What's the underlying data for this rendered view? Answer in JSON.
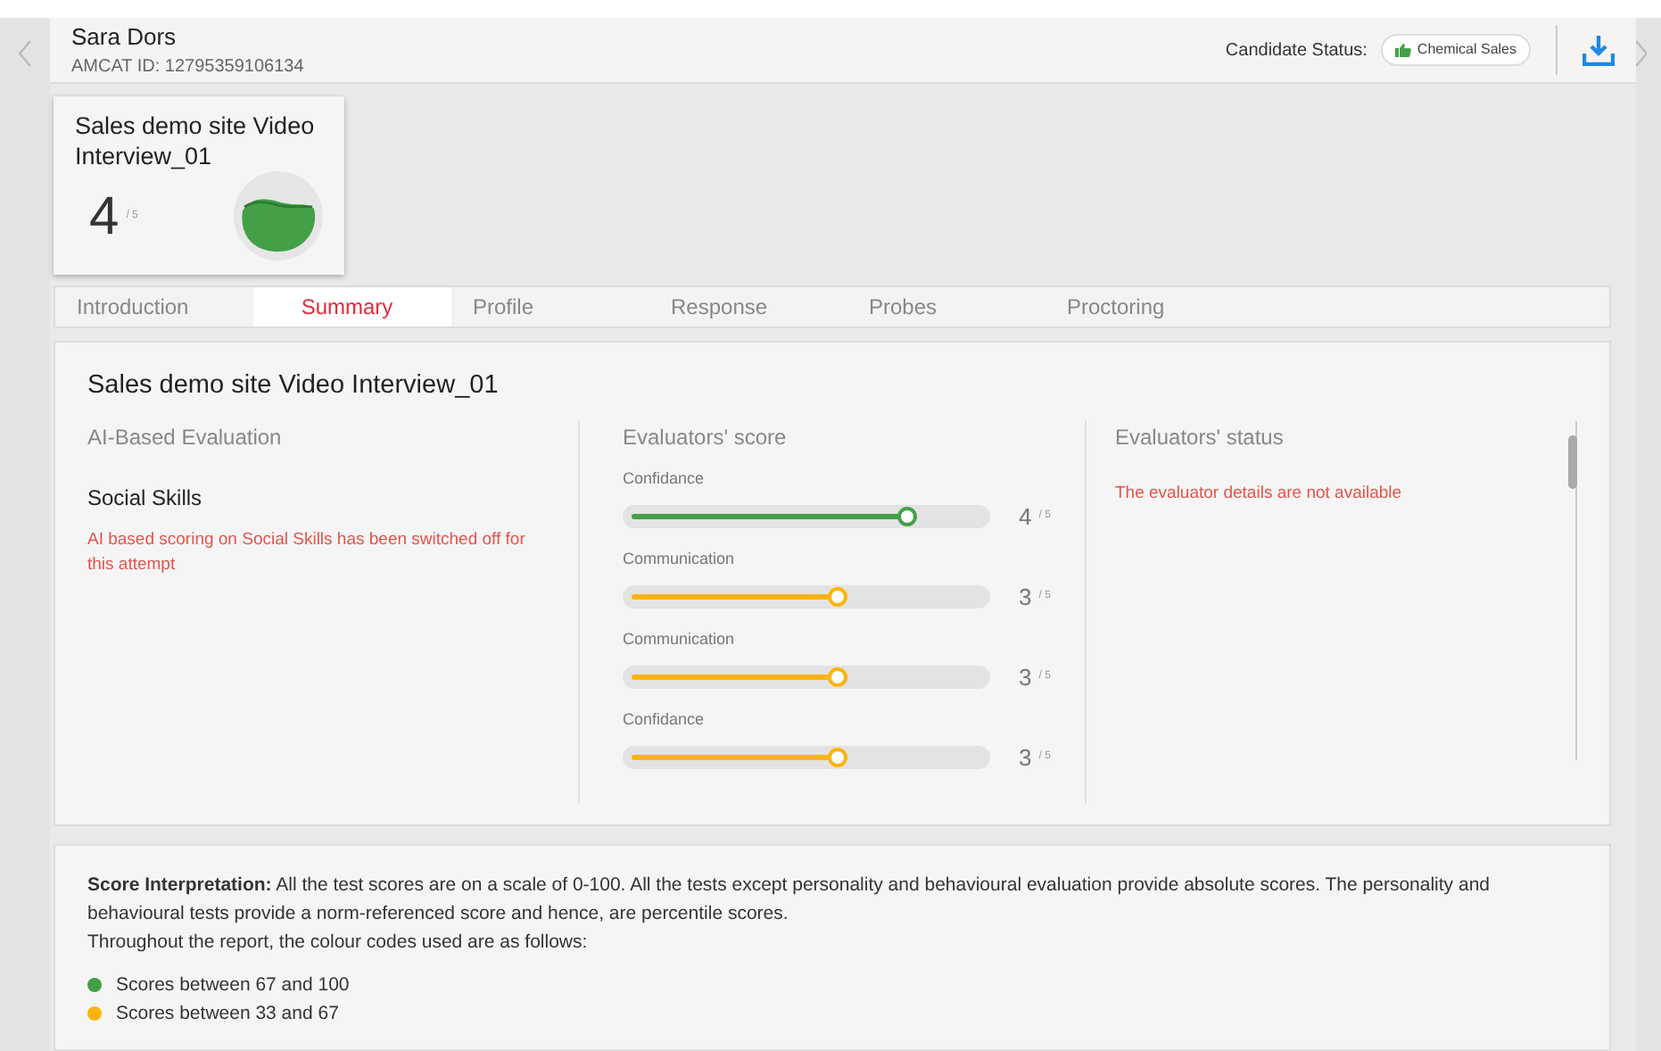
{
  "header": {
    "name": "Sara Dors",
    "id_line": "AMCAT ID: 12795359106134",
    "status_label": "Candidate Status:",
    "status_badge": "Chemical Sales"
  },
  "score_card": {
    "title": "Sales demo site Video Interview_01",
    "score": "4",
    "out_of": "/ 5"
  },
  "tabs": [
    {
      "label": "Introduction",
      "selected": false
    },
    {
      "label": "Summary",
      "selected": true
    },
    {
      "label": "Profile",
      "selected": false
    },
    {
      "label": "Response",
      "selected": false
    },
    {
      "label": "Probes",
      "selected": false
    },
    {
      "label": "Proctoring",
      "selected": false
    }
  ],
  "summary": {
    "title": "Sales demo site Video Interview_01",
    "ai_evaluation": {
      "heading": "AI-Based Evaluation",
      "skill": "Social Skills",
      "message": "AI based scoring on Social Skills has been switched off for this attempt"
    },
    "evaluators_score": {
      "heading": "Evaluators' score",
      "items": [
        {
          "label": "Confidance",
          "level": 0.8,
          "color": "#43a047",
          "score": "4",
          "out_of": "/ 5"
        },
        {
          "label": "Communication",
          "level": 0.6,
          "color": "#fbb40f",
          "score": "3",
          "out_of": "/ 5"
        },
        {
          "label": "Communication",
          "level": 0.6,
          "color": "#fbb40f",
          "score": "3",
          "out_of": "/ 5"
        },
        {
          "label": "Confidance",
          "level": 0.6,
          "color": "#fbb40f",
          "score": "3",
          "out_of": "/ 5"
        }
      ]
    },
    "evaluators_status": {
      "heading": "Evaluators' status",
      "message": "The evaluator details are not available"
    }
  },
  "interpretation": {
    "paragraph": "**Score Interpretation:** All the test scores are on a scale of 0-100. All the tests except personality and behavioural evaluation provide absolute scores. The personality and behavioural tests provide a norm-referenced score and hence, are percentile scores.",
    "intro": "Throughout the report, the colour codes used are as follows:",
    "legend": [
      {
        "label": "Scores between 67 and 100",
        "color": "#43a047"
      },
      {
        "label": "Scores between 33 and 67",
        "color": "#fbb40f"
      }
    ]
  }
}
